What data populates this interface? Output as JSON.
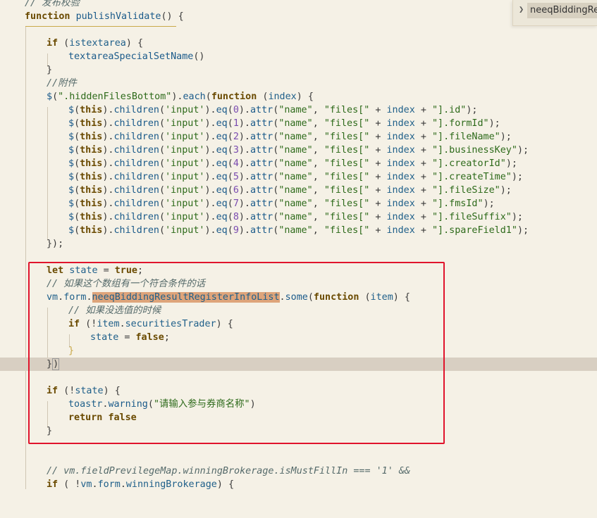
{
  "window": {
    "title": ""
  },
  "breadcrumb_widget": {
    "text": "neeqBiddingRes"
  },
  "code_lines": [
    "// 发布校验",
    "function publishValidate() {",
    "",
    "    if (istextarea) {",
    "        textareaSpecialSetName()",
    "    }",
    "    //附件",
    "    $(\".hiddenFilesBottom\").each(function (index) {",
    "        $(this).children('input').eq(0).attr(\"name\", \"files[\" + index + \"].id\");",
    "        $(this).children('input').eq(1).attr(\"name\", \"files[\" + index + \"].formId\");",
    "        $(this).children('input').eq(2).attr(\"name\", \"files[\" + index + \"].fileName\");",
    "        $(this).children('input').eq(3).attr(\"name\", \"files[\" + index + \"].businessKey\");",
    "        $(this).children('input').eq(4).attr(\"name\", \"files[\" + index + \"].creatorId\");",
    "        $(this).children('input').eq(5).attr(\"name\", \"files[\" + index + \"].createTime\");",
    "        $(this).children('input').eq(6).attr(\"name\", \"files[\" + index + \"].fileSize\");",
    "        $(this).children('input').eq(7).attr(\"name\", \"files[\" + index + \"].fmsId\");",
    "        $(this).children('input').eq(8).attr(\"name\", \"files[\" + index + \"].fileSuffix\");",
    "        $(this).children('input').eq(9).attr(\"name\", \"files[\" + index + \"].spareField1\");",
    "    });",
    "",
    "    let state = true;",
    "    // 如果这个数组有一个符合条件的话",
    "    vm.form.neeqBiddingResultRegisterInfoList.some(function (item) {",
    "        // 如果没选值的时候",
    "        if (!item.securitiesTrader) {",
    "            state = false;",
    "        }",
    "    })",
    "",
    "    if (!state) {",
    "        toastr.warning(\"请输入参与券商名称\")",
    "        return false",
    "    }",
    "",
    "",
    "    // vm.fieldPrevilegeMap.winningBrokerage.isMustFillIn === '1' &&",
    "    if ( !vm.form.winningBrokerage) {"
  ],
  "selection": {
    "text": "neeqBiddingResultRegisterInfoList"
  },
  "colors": {
    "background": "#f5f1e6",
    "current_line": "#d8cfc2",
    "selection": "#dea47a",
    "annotation_box": "#e0142c"
  }
}
